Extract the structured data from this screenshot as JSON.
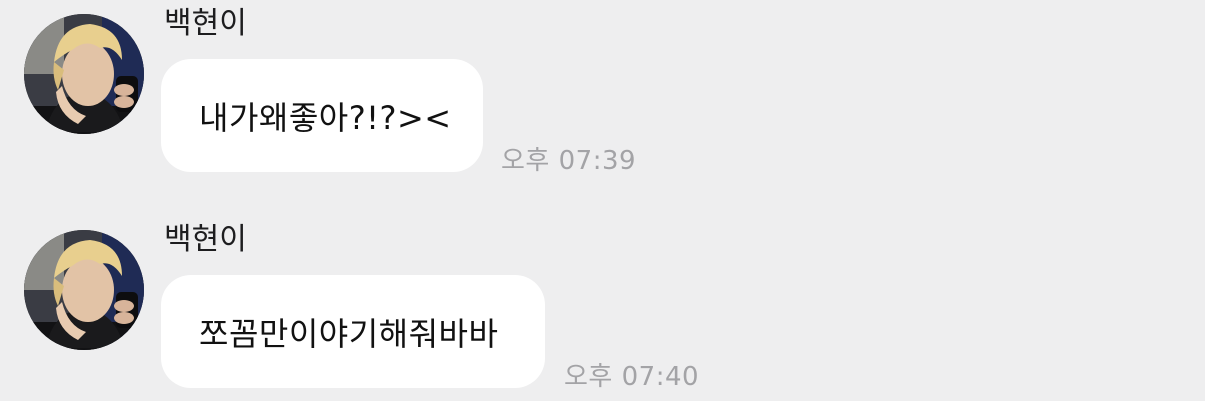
{
  "messages": [
    {
      "sender": "백현이",
      "text": "내가왜좋아?!?><",
      "time": "오후 07:39"
    },
    {
      "sender": "백현이",
      "text": "쪼꼼만이야기해줘바바",
      "time": "오후 07:40"
    }
  ],
  "colors": {
    "background": "#eeeeef",
    "bubble": "#ffffff",
    "timestamp": "#a3a3a6"
  }
}
